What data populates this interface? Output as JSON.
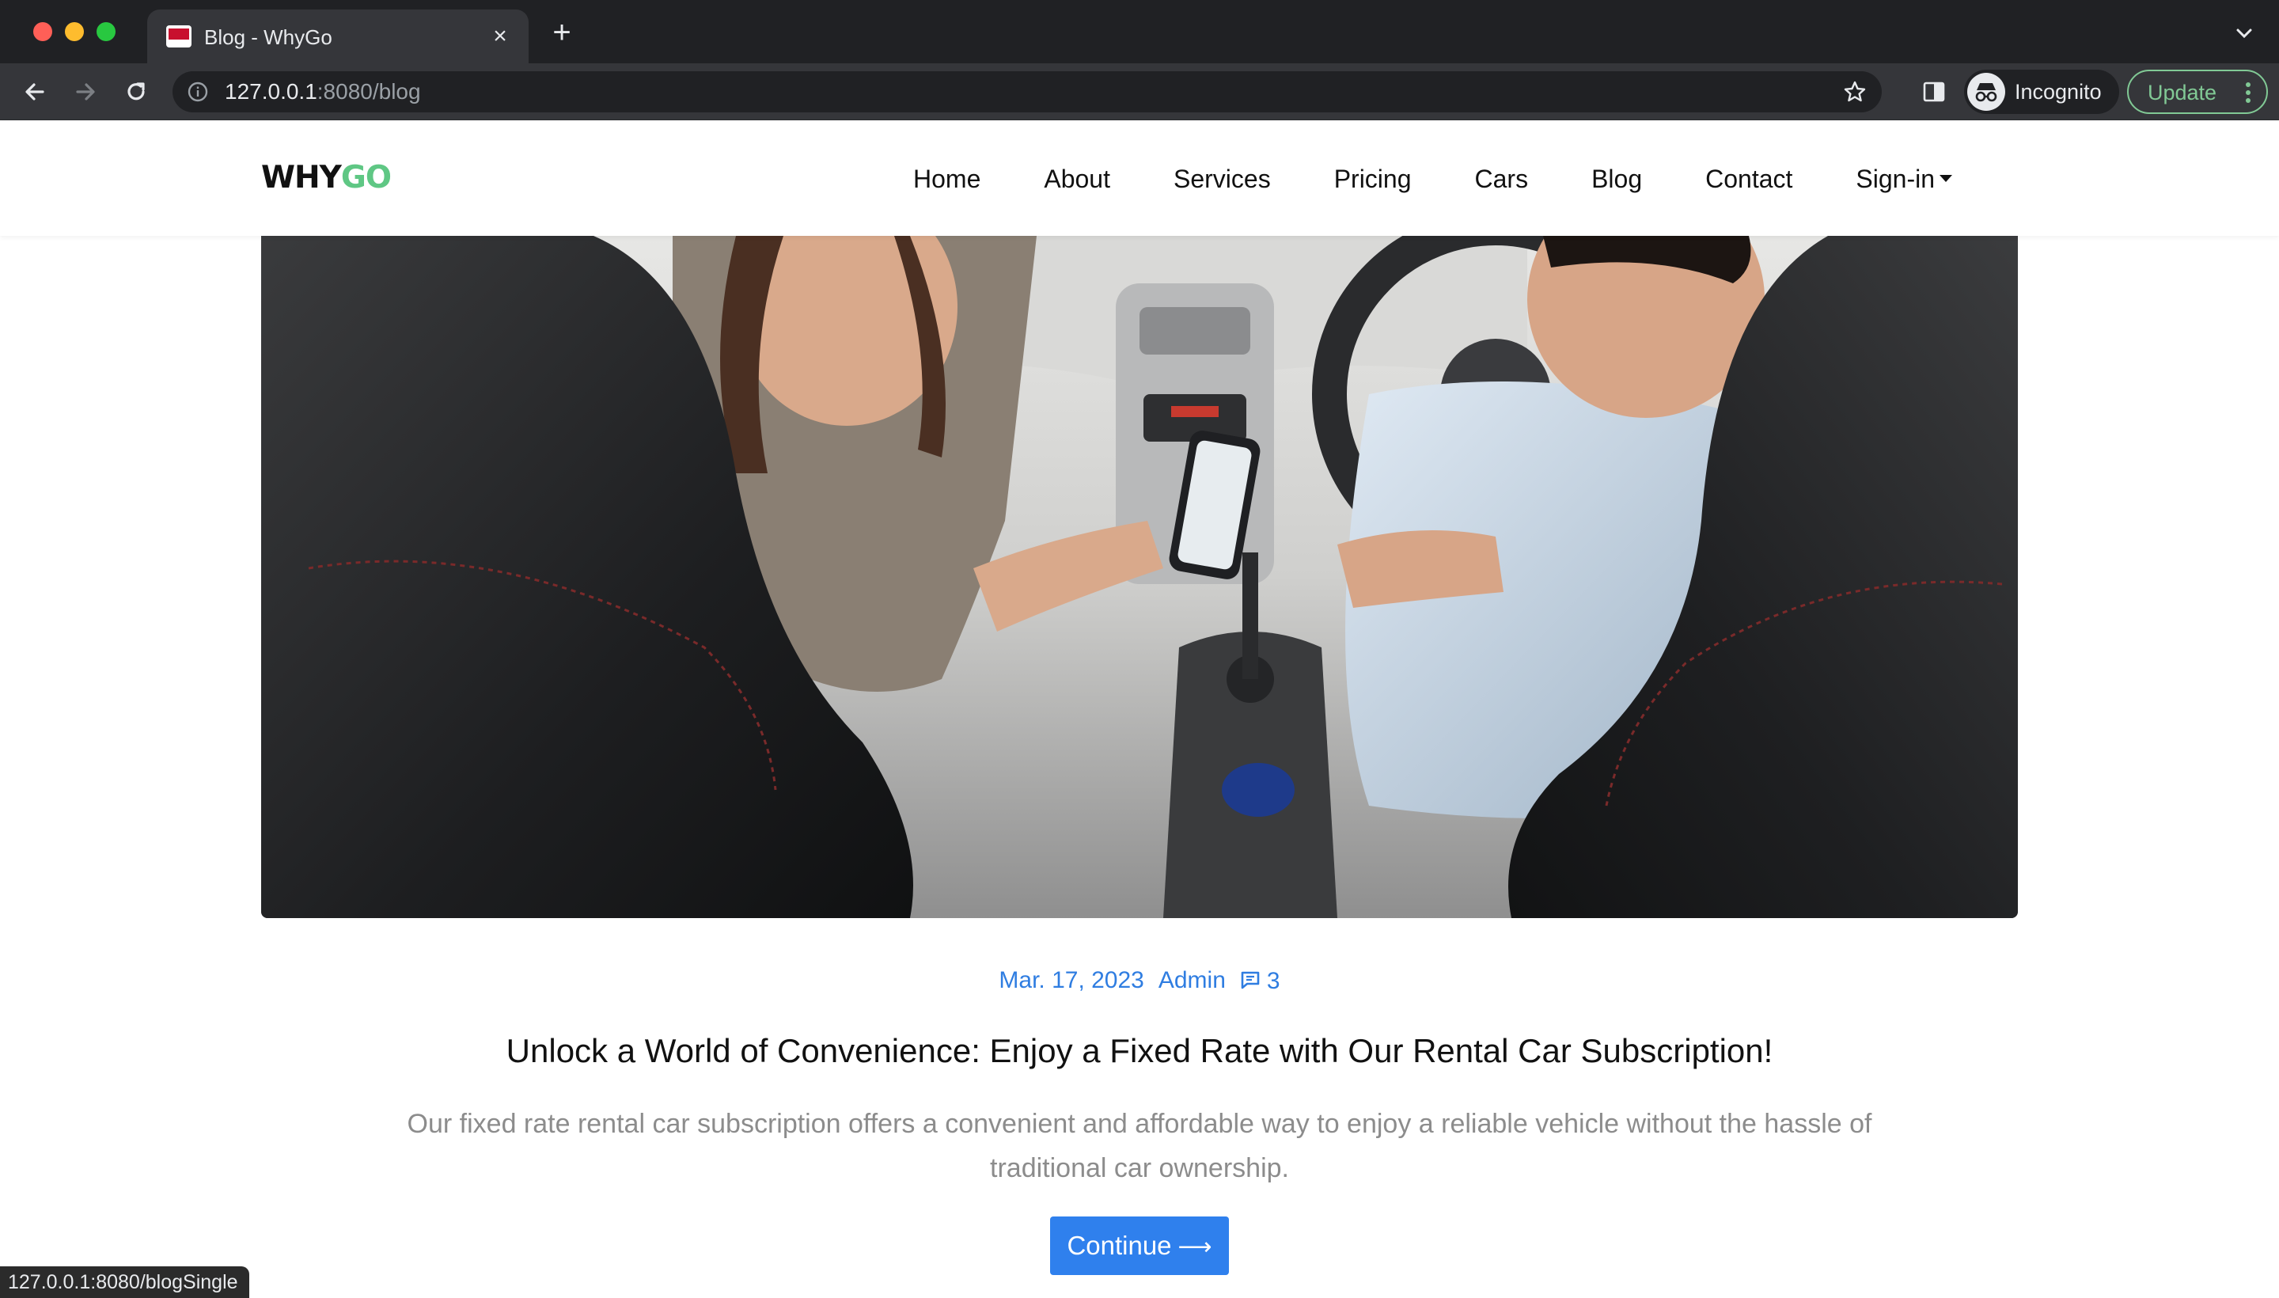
{
  "browser": {
    "tab_title": "Blog - WhyGo",
    "close_tab_icon": "×",
    "new_tab_icon": "+",
    "url_host": "127.0.0.1",
    "url_rest": ":8080/blog",
    "incognito_label": "Incognito",
    "update_label": "Update",
    "status_url": "127.0.0.1:8080/blogSingle"
  },
  "site": {
    "logo_part1": "WHY",
    "logo_part2": "GO",
    "brand_color": "#5fc784",
    "nav": {
      "home": "Home",
      "about": "About",
      "services": "Services",
      "pricing": "Pricing",
      "cars": "Cars",
      "blog": "Blog",
      "contact": "Contact",
      "signin": "Sign-in"
    }
  },
  "post": {
    "date": "Mar. 17, 2023",
    "author": "Admin",
    "comments": "3",
    "title": "Unlock a World of Convenience: Enjoy a Fixed Rate with Our Rental Car Subscription!",
    "excerpt": "Our fixed rate rental car subscription offers a convenient and affordable way to enjoy a reliable vehicle without the hassle of traditional car ownership.",
    "continue_label": "Continue",
    "continue_arrow": "⟶",
    "accent_color": "#2f80ed"
  }
}
